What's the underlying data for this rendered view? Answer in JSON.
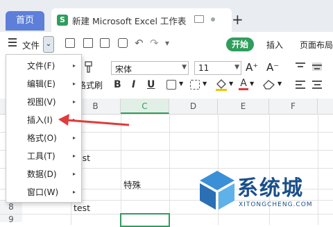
{
  "tabs": {
    "home": "首页",
    "document": {
      "icon_letter": "S",
      "title": "新建 Microsoft Excel 工作表"
    },
    "new_tab": "+"
  },
  "toolbar": {
    "file": "文件",
    "start": "开始",
    "insert": "插入",
    "page_layout": "页面布局"
  },
  "ribbon": {
    "format_painter": "格式刷",
    "font_name": "宋体",
    "font_size": "11",
    "font_size_up": "A⁺",
    "font_size_down": "A⁻",
    "bold": "B",
    "italic": "I",
    "underline": "U",
    "font_color_letter": "A"
  },
  "menu": {
    "items": [
      {
        "label": "文件(F)",
        "has_submenu": true
      },
      {
        "label": "编辑(E)",
        "has_submenu": true
      },
      {
        "label": "视图(V)",
        "has_submenu": true
      },
      {
        "label": "插入(I)",
        "has_submenu": true
      },
      {
        "label": "格式(O)",
        "has_submenu": true
      },
      {
        "label": "工具(T)",
        "has_submenu": true
      },
      {
        "label": "数据(D)",
        "has_submenu": true
      },
      {
        "label": "窗口(W)",
        "has_submenu": true
      }
    ]
  },
  "grid": {
    "columns": [
      "B",
      "C",
      "D",
      "E",
      "F"
    ],
    "rows": [
      "8",
      "9"
    ],
    "cells": {
      "b_test1": "test",
      "c_special": "特殊",
      "b_test2": "test"
    }
  },
  "watermark": {
    "text": "系统城",
    "url": "XITONGCHENG.COM"
  },
  "colors": {
    "accent_green": "#2f9d5c",
    "home_tab_blue": "#5d7fd9",
    "arrow_red": "#e03b3b",
    "watermark_blue": "#1a4f8a"
  }
}
